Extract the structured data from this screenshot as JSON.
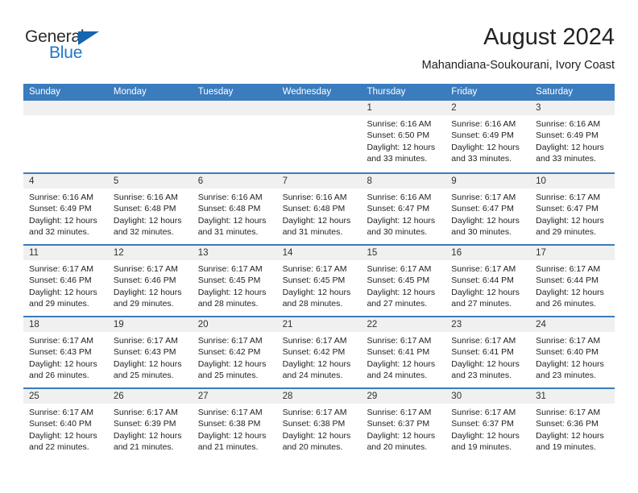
{
  "brand": {
    "name_part1": "General",
    "name_part2": "Blue"
  },
  "header": {
    "title": "August 2024",
    "subtitle": "Mahandiana-Soukourani, Ivory Coast"
  },
  "colors": {
    "header_blue": "#3a7cbe",
    "date_band": "#f0f0f0",
    "logo_blue": "#2176c7",
    "triangle_blue": "#1565b0"
  },
  "weekdays": [
    "Sunday",
    "Monday",
    "Tuesday",
    "Wednesday",
    "Thursday",
    "Friday",
    "Saturday"
  ],
  "labels": {
    "sunrise_prefix": "Sunrise:",
    "sunset_prefix": "Sunset:",
    "daylight_prefix": "Daylight:"
  },
  "weeks": [
    [
      {
        "day": "",
        "empty": true
      },
      {
        "day": "",
        "empty": true
      },
      {
        "day": "",
        "empty": true
      },
      {
        "day": "",
        "empty": true
      },
      {
        "day": "1",
        "sunrise": "Sunrise: 6:16 AM",
        "sunset": "Sunset: 6:50 PM",
        "daylight1": "Daylight: 12 hours",
        "daylight2": "and 33 minutes."
      },
      {
        "day": "2",
        "sunrise": "Sunrise: 6:16 AM",
        "sunset": "Sunset: 6:49 PM",
        "daylight1": "Daylight: 12 hours",
        "daylight2": "and 33 minutes."
      },
      {
        "day": "3",
        "sunrise": "Sunrise: 6:16 AM",
        "sunset": "Sunset: 6:49 PM",
        "daylight1": "Daylight: 12 hours",
        "daylight2": "and 33 minutes."
      }
    ],
    [
      {
        "day": "4",
        "sunrise": "Sunrise: 6:16 AM",
        "sunset": "Sunset: 6:49 PM",
        "daylight1": "Daylight: 12 hours",
        "daylight2": "and 32 minutes."
      },
      {
        "day": "5",
        "sunrise": "Sunrise: 6:16 AM",
        "sunset": "Sunset: 6:48 PM",
        "daylight1": "Daylight: 12 hours",
        "daylight2": "and 32 minutes."
      },
      {
        "day": "6",
        "sunrise": "Sunrise: 6:16 AM",
        "sunset": "Sunset: 6:48 PM",
        "daylight1": "Daylight: 12 hours",
        "daylight2": "and 31 minutes."
      },
      {
        "day": "7",
        "sunrise": "Sunrise: 6:16 AM",
        "sunset": "Sunset: 6:48 PM",
        "daylight1": "Daylight: 12 hours",
        "daylight2": "and 31 minutes."
      },
      {
        "day": "8",
        "sunrise": "Sunrise: 6:16 AM",
        "sunset": "Sunset: 6:47 PM",
        "daylight1": "Daylight: 12 hours",
        "daylight2": "and 30 minutes."
      },
      {
        "day": "9",
        "sunrise": "Sunrise: 6:17 AM",
        "sunset": "Sunset: 6:47 PM",
        "daylight1": "Daylight: 12 hours",
        "daylight2": "and 30 minutes."
      },
      {
        "day": "10",
        "sunrise": "Sunrise: 6:17 AM",
        "sunset": "Sunset: 6:47 PM",
        "daylight1": "Daylight: 12 hours",
        "daylight2": "and 29 minutes."
      }
    ],
    [
      {
        "day": "11",
        "sunrise": "Sunrise: 6:17 AM",
        "sunset": "Sunset: 6:46 PM",
        "daylight1": "Daylight: 12 hours",
        "daylight2": "and 29 minutes."
      },
      {
        "day": "12",
        "sunrise": "Sunrise: 6:17 AM",
        "sunset": "Sunset: 6:46 PM",
        "daylight1": "Daylight: 12 hours",
        "daylight2": "and 29 minutes."
      },
      {
        "day": "13",
        "sunrise": "Sunrise: 6:17 AM",
        "sunset": "Sunset: 6:45 PM",
        "daylight1": "Daylight: 12 hours",
        "daylight2": "and 28 minutes."
      },
      {
        "day": "14",
        "sunrise": "Sunrise: 6:17 AM",
        "sunset": "Sunset: 6:45 PM",
        "daylight1": "Daylight: 12 hours",
        "daylight2": "and 28 minutes."
      },
      {
        "day": "15",
        "sunrise": "Sunrise: 6:17 AM",
        "sunset": "Sunset: 6:45 PM",
        "daylight1": "Daylight: 12 hours",
        "daylight2": "and 27 minutes."
      },
      {
        "day": "16",
        "sunrise": "Sunrise: 6:17 AM",
        "sunset": "Sunset: 6:44 PM",
        "daylight1": "Daylight: 12 hours",
        "daylight2": "and 27 minutes."
      },
      {
        "day": "17",
        "sunrise": "Sunrise: 6:17 AM",
        "sunset": "Sunset: 6:44 PM",
        "daylight1": "Daylight: 12 hours",
        "daylight2": "and 26 minutes."
      }
    ],
    [
      {
        "day": "18",
        "sunrise": "Sunrise: 6:17 AM",
        "sunset": "Sunset: 6:43 PM",
        "daylight1": "Daylight: 12 hours",
        "daylight2": "and 26 minutes."
      },
      {
        "day": "19",
        "sunrise": "Sunrise: 6:17 AM",
        "sunset": "Sunset: 6:43 PM",
        "daylight1": "Daylight: 12 hours",
        "daylight2": "and 25 minutes."
      },
      {
        "day": "20",
        "sunrise": "Sunrise: 6:17 AM",
        "sunset": "Sunset: 6:42 PM",
        "daylight1": "Daylight: 12 hours",
        "daylight2": "and 25 minutes."
      },
      {
        "day": "21",
        "sunrise": "Sunrise: 6:17 AM",
        "sunset": "Sunset: 6:42 PM",
        "daylight1": "Daylight: 12 hours",
        "daylight2": "and 24 minutes."
      },
      {
        "day": "22",
        "sunrise": "Sunrise: 6:17 AM",
        "sunset": "Sunset: 6:41 PM",
        "daylight1": "Daylight: 12 hours",
        "daylight2": "and 24 minutes."
      },
      {
        "day": "23",
        "sunrise": "Sunrise: 6:17 AM",
        "sunset": "Sunset: 6:41 PM",
        "daylight1": "Daylight: 12 hours",
        "daylight2": "and 23 minutes."
      },
      {
        "day": "24",
        "sunrise": "Sunrise: 6:17 AM",
        "sunset": "Sunset: 6:40 PM",
        "daylight1": "Daylight: 12 hours",
        "daylight2": "and 23 minutes."
      }
    ],
    [
      {
        "day": "25",
        "sunrise": "Sunrise: 6:17 AM",
        "sunset": "Sunset: 6:40 PM",
        "daylight1": "Daylight: 12 hours",
        "daylight2": "and 22 minutes."
      },
      {
        "day": "26",
        "sunrise": "Sunrise: 6:17 AM",
        "sunset": "Sunset: 6:39 PM",
        "daylight1": "Daylight: 12 hours",
        "daylight2": "and 21 minutes."
      },
      {
        "day": "27",
        "sunrise": "Sunrise: 6:17 AM",
        "sunset": "Sunset: 6:38 PM",
        "daylight1": "Daylight: 12 hours",
        "daylight2": "and 21 minutes."
      },
      {
        "day": "28",
        "sunrise": "Sunrise: 6:17 AM",
        "sunset": "Sunset: 6:38 PM",
        "daylight1": "Daylight: 12 hours",
        "daylight2": "and 20 minutes."
      },
      {
        "day": "29",
        "sunrise": "Sunrise: 6:17 AM",
        "sunset": "Sunset: 6:37 PM",
        "daylight1": "Daylight: 12 hours",
        "daylight2": "and 20 minutes."
      },
      {
        "day": "30",
        "sunrise": "Sunrise: 6:17 AM",
        "sunset": "Sunset: 6:37 PM",
        "daylight1": "Daylight: 12 hours",
        "daylight2": "and 19 minutes."
      },
      {
        "day": "31",
        "sunrise": "Sunrise: 6:17 AM",
        "sunset": "Sunset: 6:36 PM",
        "daylight1": "Daylight: 12 hours",
        "daylight2": "and 19 minutes."
      }
    ]
  ]
}
